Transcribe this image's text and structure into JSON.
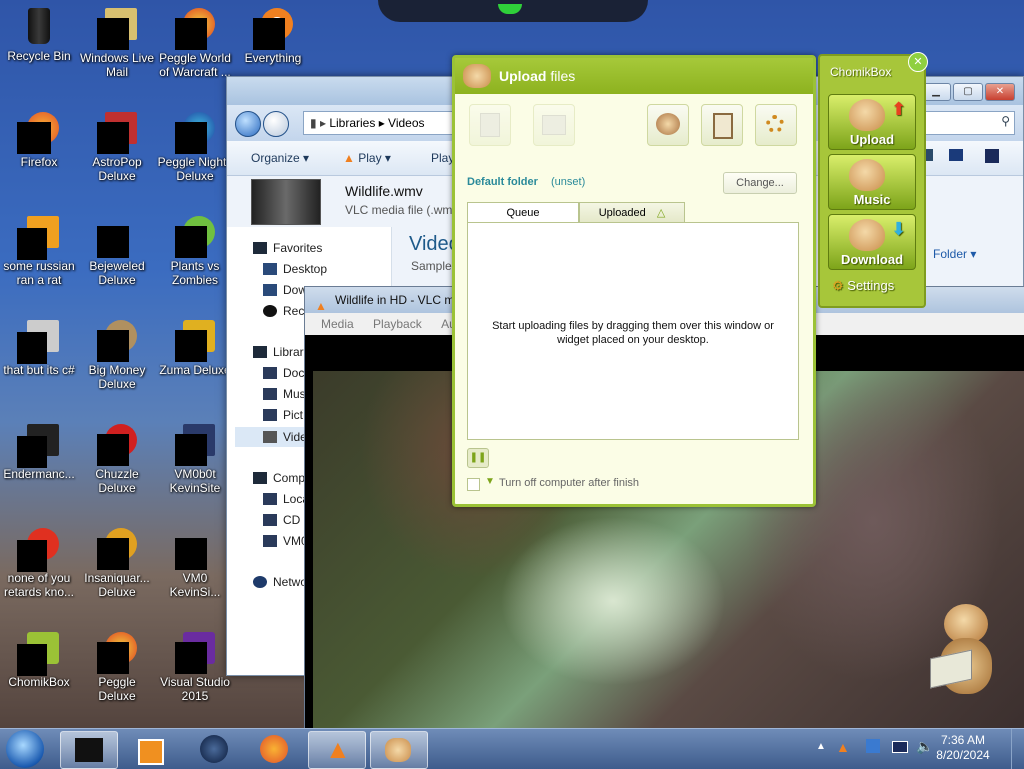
{
  "desktop": {
    "icons": [
      {
        "label": "Recycle Bin"
      },
      {
        "label": "Windows Live Mail"
      },
      {
        "label": "Peggle World of Warcraft ..."
      },
      {
        "label": "Everything"
      },
      {
        "label": "Firefox"
      },
      {
        "label": "AstroPop Deluxe"
      },
      {
        "label": "Peggle Nights Deluxe"
      },
      {
        "label": "some russian ran a rat"
      },
      {
        "label": "Bejeweled Deluxe"
      },
      {
        "label": "Plants vs Zombies"
      },
      {
        "label": "that but its c#"
      },
      {
        "label": "Big Money Deluxe"
      },
      {
        "label": "Zuma Deluxe"
      },
      {
        "label": "Endermanc..."
      },
      {
        "label": "Chuzzle Deluxe"
      },
      {
        "label": "VM0b0t KevinSite"
      },
      {
        "label": "none of you retards kno..."
      },
      {
        "label": "Insaniquar... Deluxe"
      },
      {
        "label": "VM0 KevinSi..."
      },
      {
        "label": "ChomikBox"
      },
      {
        "label": "Peggle Deluxe"
      },
      {
        "label": "Visual Studio 2015"
      }
    ]
  },
  "explorer": {
    "breadcrumb": [
      "Libraries",
      "Videos"
    ],
    "toolbar": {
      "organize": "Organize",
      "play": "Play",
      "play2": "Play"
    },
    "file": {
      "name": "Wildlife.wmv",
      "type": "VLC media file (.wmv"
    },
    "library_title": "Video",
    "library_sub": "Sample",
    "arrange_by": "Folder",
    "nav": {
      "favorites": "Favorites",
      "desktop": "Desktop",
      "downloads": "Dow",
      "recent": "Rece",
      "libraries": "Librar",
      "documents": "Doc",
      "music": "Mus",
      "pictures": "Pict",
      "videos": "Vide",
      "computer": "Comp",
      "local": "Loca",
      "cd": "CD I",
      "vm": "VM0",
      "network": "Netwo"
    }
  },
  "vlc": {
    "title": "Wildlife in HD - VLC m",
    "menu": [
      "Media",
      "Playback",
      "Aud"
    ]
  },
  "upload": {
    "title_bold": "Upload",
    "title_rest": "files",
    "default_folder_label": "Default folder",
    "default_folder_value": "(unset)",
    "change_button": "Change...",
    "tabs": {
      "queue": "Queue",
      "uploaded": "Uploaded"
    },
    "hint": "Start uploading files by dragging them over this window or widget placed on your desktop.",
    "turn_off_label": "Turn off computer after finish"
  },
  "chomikbox": {
    "title": "ChomikBox",
    "upload": "Upload",
    "music": "Music",
    "download": "Download",
    "settings": "Settings"
  },
  "taskbar": {
    "time": "7:36 AM",
    "date": "8/20/2024"
  },
  "colors": {
    "chomik_green": "#9bc236",
    "link_teal": "#2a8a9a"
  }
}
